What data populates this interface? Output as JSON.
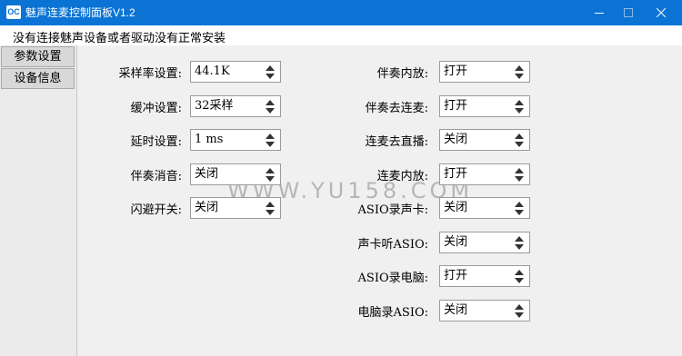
{
  "window": {
    "title": "魅声连麦控制面板V1.2",
    "icon_text": "OC"
  },
  "status": "没有连接魅声设备或者驱动没有正常安装",
  "nav": [
    {
      "label": "参数设置"
    },
    {
      "label": "设备信息"
    }
  ],
  "left_settings": [
    {
      "label": "采样率设置:",
      "value": "44.1K"
    },
    {
      "label": "缓冲设置:",
      "value": "32采样"
    },
    {
      "label": "延时设置:",
      "value": "1 ms"
    },
    {
      "label": "伴奏消音:",
      "value": "关闭"
    },
    {
      "label": "闪避开关:",
      "value": "关闭"
    }
  ],
  "right_settings": [
    {
      "label": "伴奏内放:",
      "value": "打开"
    },
    {
      "label": "伴奏去连麦:",
      "value": "打开"
    },
    {
      "label": "连麦去直播:",
      "value": "关闭"
    },
    {
      "label": "连麦内放:",
      "value": "打开"
    },
    {
      "label": "ASIO录声卡:",
      "value": "关闭"
    },
    {
      "label": "声卡听ASIO:",
      "value": "关闭"
    },
    {
      "label": "ASIO录电脑:",
      "value": "打开"
    },
    {
      "label": "电脑录ASIO:",
      "value": "关闭"
    }
  ],
  "watermark": "WWW.YU158.COM",
  "colors": {
    "titlebar": "#0a73d4",
    "panel": "#f0f0f0",
    "nav_bg": "#ebebeb"
  }
}
